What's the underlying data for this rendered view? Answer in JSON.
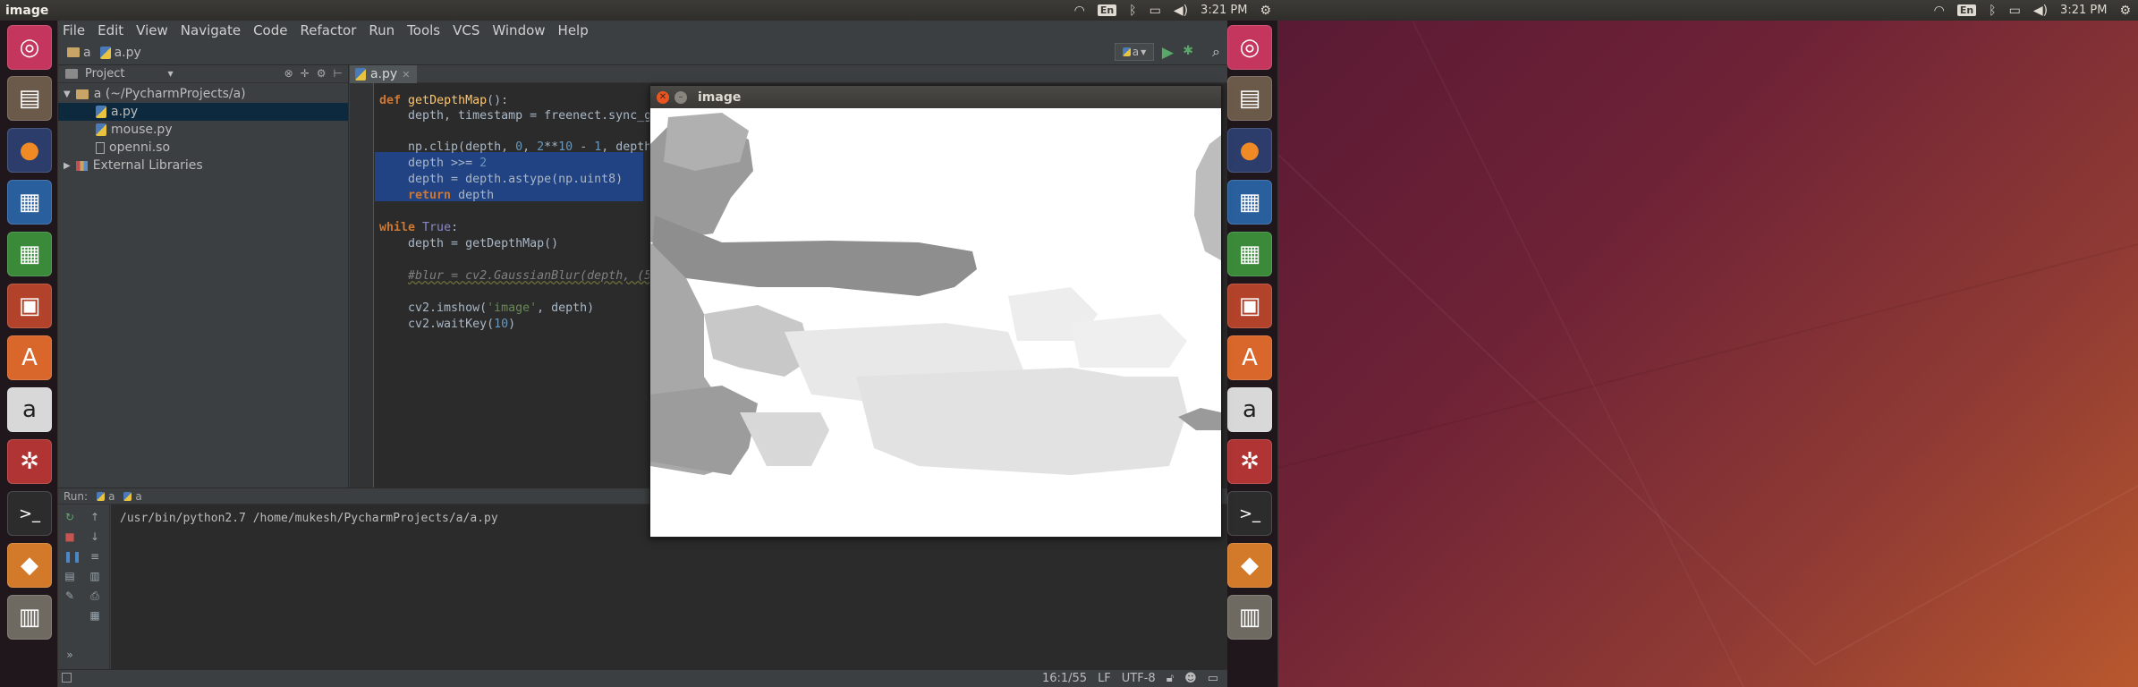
{
  "top_panel": {
    "title": "image",
    "input_indicator": "En",
    "clock": "3:21 PM"
  },
  "launcher_icons": [
    "ubuntu-dash-icon",
    "files-icon",
    "firefox-icon",
    "writer-icon",
    "calc-icon",
    "impress-icon",
    "software-center-icon",
    "amazon-icon",
    "system-settings-icon",
    "terminal-icon",
    "pycharm-icon",
    "trash-icon"
  ],
  "ide": {
    "menu": [
      "File",
      "Edit",
      "View",
      "Navigate",
      "Code",
      "Refactor",
      "Run",
      "Tools",
      "VCS",
      "Window",
      "Help"
    ],
    "breadcrumb": {
      "folder": "a",
      "file": "a.py"
    },
    "run_config": "a",
    "project_panel": {
      "title": "Project",
      "root": "a (~/PycharmProjects/a)",
      "files": [
        "a.py",
        "mouse.py",
        "openni.so"
      ],
      "external": "External Libraries"
    },
    "editor": {
      "tab": "a.py",
      "lines": {
        "l0": "\"\"\"",
        "l1_kw": "def",
        "l1_fn": "getDepthMap",
        "l1_rest": "():",
        "l2": "    depth, timestamp = freenect.sync_g",
        "l3a": "    np.clip(depth, ",
        "l3n1": "0",
        "l3b": ", ",
        "l3n2": "2",
        "l3c": "**",
        "l3n3": "10",
        "l3d": " - ",
        "l3n4": "1",
        "l3e": ", depth",
        "l4a": "    depth >>= ",
        "l4n": "2",
        "l5": "    depth = depth.astype(np.uint8)",
        "l6_kw": "return",
        "l6_rest": " depth",
        "l7_kw": "while",
        "l7_bi": "True",
        "l7_rest": ":",
        "l8": "    depth = getDepthMap()",
        "l9": "#blur = cv2.GaussianBlur(depth, (5",
        "l10a": "    cv2.imshow(",
        "l10s": "'image'",
        "l10b": ", depth)",
        "l11a": "    cv2.waitKey(",
        "l11n": "10",
        "l11b": ")"
      }
    },
    "run": {
      "label": "Run:",
      "tabs": [
        "a",
        "a"
      ],
      "output": "/usr/bin/python2.7 /home/mukesh/PycharmProjects/a/a.py"
    },
    "status": {
      "position": "16:1/55",
      "line_sep": "LF",
      "encoding": "UTF-8"
    }
  },
  "image_window": {
    "title": "image"
  }
}
